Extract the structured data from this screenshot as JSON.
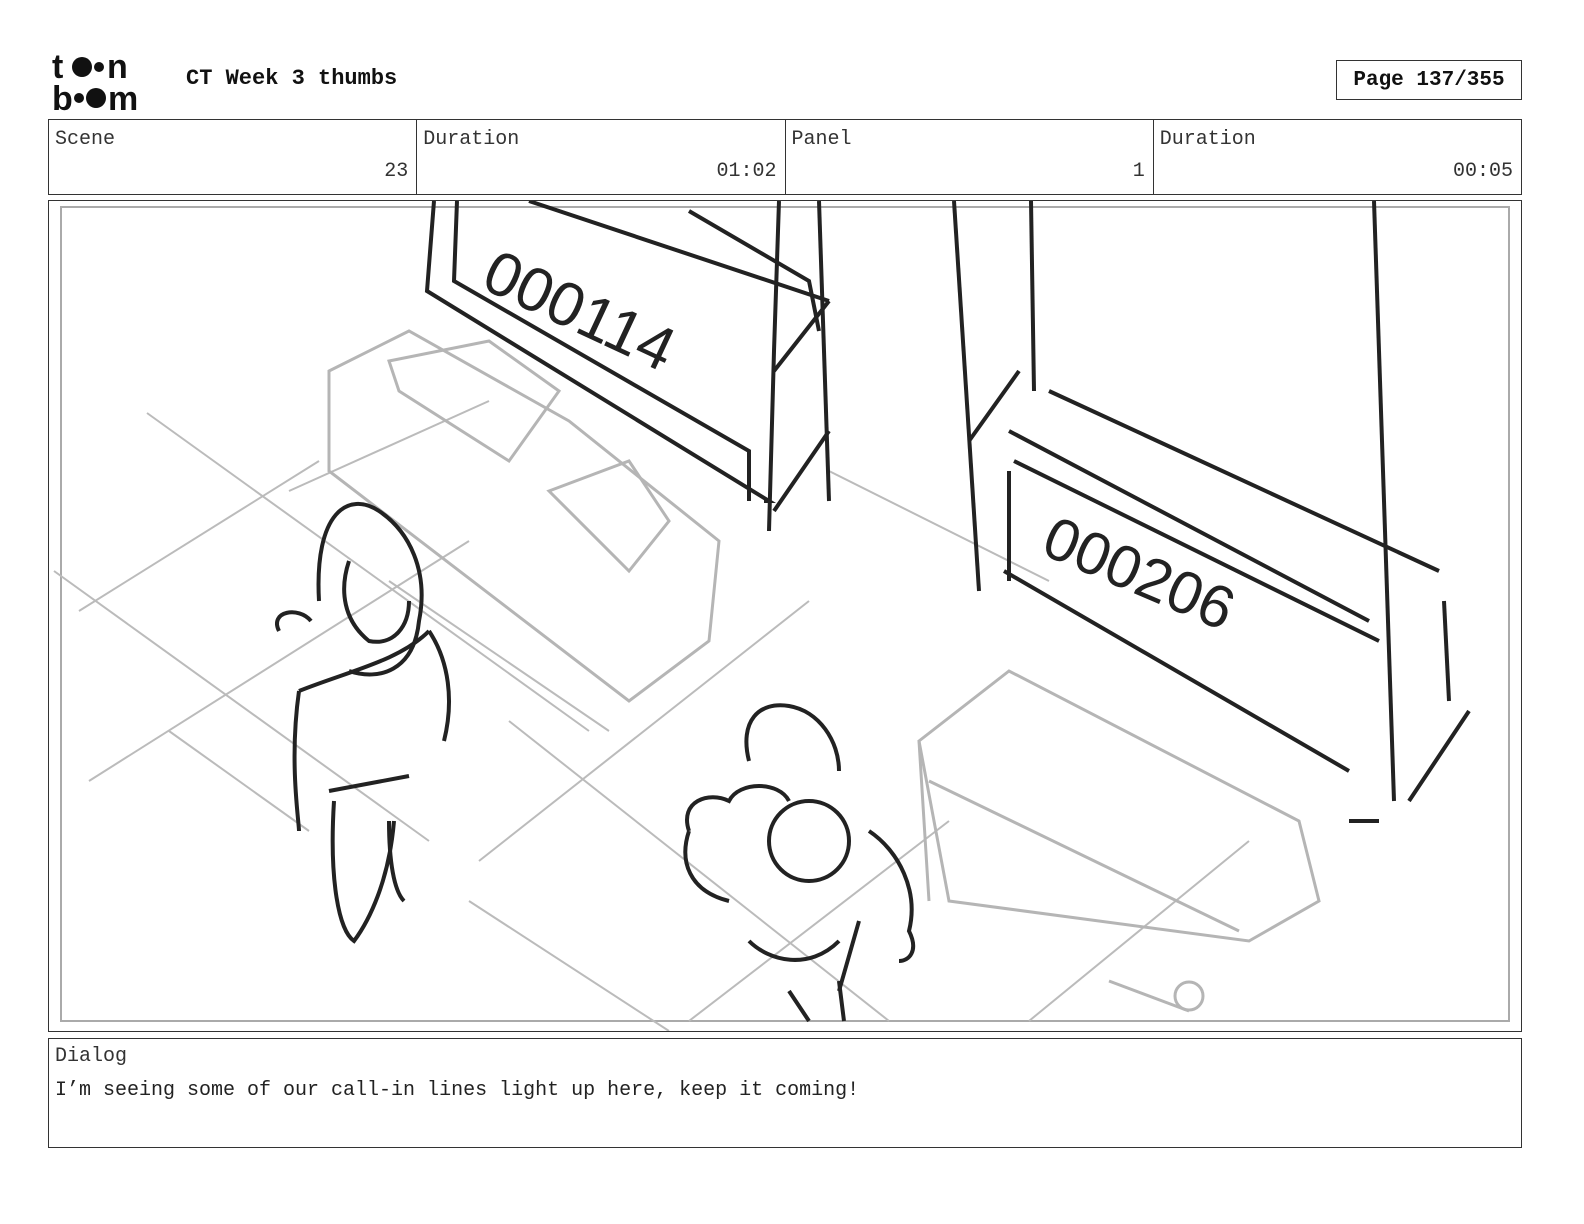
{
  "header": {
    "logo_text": "toon boom",
    "title": "CT Week 3 thumbs",
    "page": "Page 137/355"
  },
  "info": {
    "scene_label": "Scene",
    "scene_value": "23",
    "scene_duration_label": "Duration",
    "scene_duration_value": "01:02",
    "panel_label": "Panel",
    "panel_value": "1",
    "panel_duration_label": "Duration",
    "panel_duration_value": "00:05"
  },
  "artwork": {
    "left_screen_number": "000114",
    "right_screen_number": "000206"
  },
  "dialog": {
    "label": "Dialog",
    "text": "I’m seeing some of our call-in lines light up here, keep it coming!"
  }
}
